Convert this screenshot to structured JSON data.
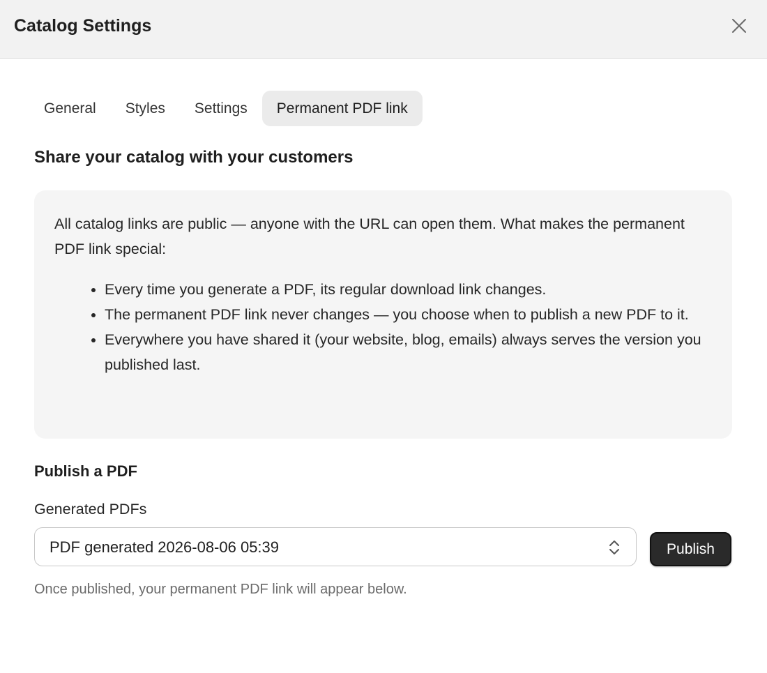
{
  "header": {
    "title": "Catalog Settings",
    "close_icon": "close-icon"
  },
  "tabs": [
    {
      "label": "General",
      "active": false
    },
    {
      "label": "Styles",
      "active": false
    },
    {
      "label": "Settings",
      "active": false
    },
    {
      "label": "Permanent PDF link",
      "active": true
    }
  ],
  "share": {
    "title": "Share your catalog with your customers",
    "intro": "All catalog links are public — anyone with the URL can open them. What makes the permanent PDF link special:",
    "bullets": [
      "Every time you generate a PDF, its regular download link changes.",
      "The permanent PDF link never changes — you choose when to publish a new PDF to it.",
      "Everywhere you have shared it (your website, blog, emails) always serves the version you published last."
    ]
  },
  "publish": {
    "heading": "Publish a PDF",
    "field_label": "Generated PDFs",
    "selected_option": "PDF generated 2026-08-06 05:39",
    "chevron_icon": "up-down-chevron-icon",
    "button_label": "Publish",
    "helper_text": "Once published, your permanent PDF link will appear below."
  },
  "colors": {
    "header_bg": "#f2f2f2",
    "active_tab_bg": "#ebebeb",
    "info_box_bg": "#f5f5f5",
    "button_bg": "#2a2a2a",
    "helper_text": "#6b6b6b"
  }
}
